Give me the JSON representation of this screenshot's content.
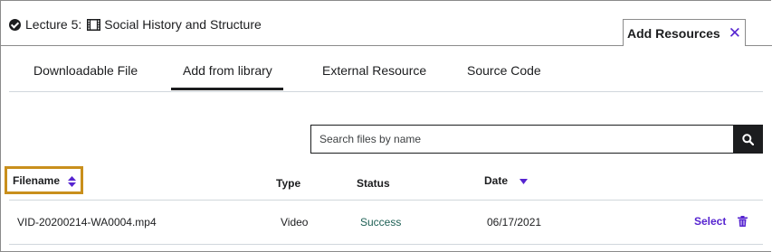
{
  "header": {
    "lecture_label": "Lecture 5:",
    "lecture_title": "Social History and Structure"
  },
  "add_resources": {
    "label": "Add Resources"
  },
  "tabs": [
    {
      "label": "Downloadable File"
    },
    {
      "label": "Add from library"
    },
    {
      "label": "External Resource"
    },
    {
      "label": "Source Code"
    }
  ],
  "active_tab": "Add from library",
  "search": {
    "placeholder": "Search files by name",
    "value": ""
  },
  "table": {
    "columns": {
      "filename": "Filename",
      "type": "Type",
      "status": "Status",
      "date": "Date"
    },
    "rows": [
      {
        "filename": "VID-20200214-WA0004.mp4",
        "type": "Video",
        "status": "Success",
        "date": "06/17/2021",
        "action": "Select"
      }
    ]
  },
  "colors": {
    "accent": "#5624d0",
    "text": "#1c1d1f",
    "success": "#1e6055",
    "highlight": "#c98f1c"
  },
  "icons": [
    "check-circle-icon",
    "film-icon",
    "close-icon",
    "search-icon",
    "sort-icon",
    "sort-down-icon",
    "trash-icon"
  ]
}
